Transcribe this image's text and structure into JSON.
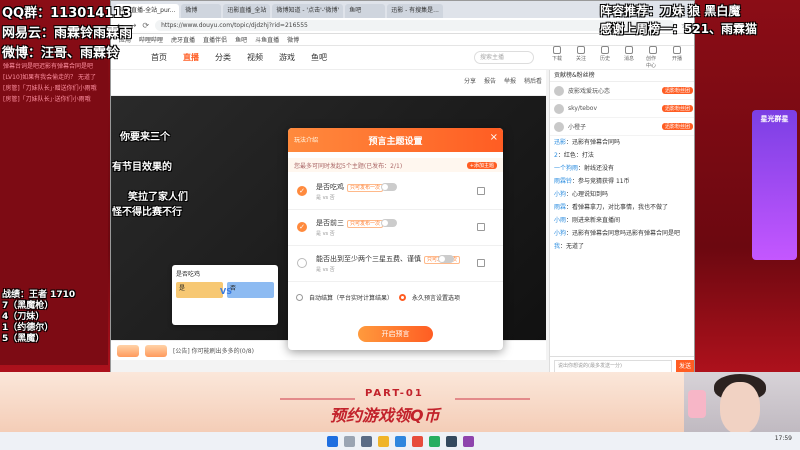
{
  "overlay": {
    "qq_group": "QQ群：113014113",
    "netease": "网易云：雨霖铃雨霖雨",
    "weibo": "微博：汪哥、雨霖铃",
    "recommend": "阵容推荐：刀妹 狼 黑白魔",
    "thanks": "感谢上周榜一：521、雨霖猫",
    "side_line1": "你要来三个",
    "side_line2": "有节目效果的",
    "side_line3": "笑拉了家人们",
    "side_line4": "怪不得比赛不行",
    "battle": [
      "战绩：王者 1710",
      "7（黑魔枪）",
      "4（刀妹）",
      "1（约德尔）",
      "5（黑魔）"
    ]
  },
  "left_chat": [
    "弹幕台词是吧迟影有弹幕合同是吧",
    "[LV10]如果有我会偷走的？ 无道了",
    "[房管]「刀妹队长」·赠送你们小雨哦",
    "[房管]「刀妹队长」·送你们小雨哦"
  ],
  "browser": {
    "tabs": [
      "斗鱼直播-全站_pur...",
      "微博",
      "迅影直播_全站",
      "微博知道 - '点击'-'微博'",
      "鱼吧",
      "迅影 - 有搜集是..."
    ],
    "url": "https://www.douyu.com/topic/djdzhj?rid=216555",
    "bookmarks": [
      "应用",
      "哔哩哔哩",
      "虎牙直播",
      "直播伴侣",
      "鱼吧",
      "斗鱼直播",
      "微博"
    ]
  },
  "nav": {
    "items": [
      "首页",
      "直播",
      "分类",
      "视频",
      "游戏",
      "鱼吧"
    ],
    "search_placeholder": "搜索主播",
    "icons": [
      "下载",
      "关注",
      "历史",
      "消息",
      "创作中心",
      "开播"
    ]
  },
  "room": {
    "actions": [
      "分享",
      "报告",
      "举报",
      "稍后看"
    ]
  },
  "gift_bar": {
    "text": "[公告] 你可能刷出多多的(0/8)"
  },
  "chat": {
    "header": "贡献榜&粉丝榜",
    "ranks": [
      {
        "name": "皮影戏爱玩心恋",
        "badge": "迅影粉丝团"
      },
      {
        "name": "sky/tebov",
        "badge": "迅影粉丝团"
      },
      {
        "name": "小橙子",
        "badge": "迅影粉丝团"
      }
    ],
    "messages": [
      {
        "user": "迅影",
        "text": "迅影有弹幕合同吗"
      },
      {
        "user": "2",
        "text": "红色：打法"
      },
      {
        "user": "一个狗雨",
        "text": "射线还没有"
      },
      {
        "user": "雨霖铃",
        "text": "参与竞猜获得 11币"
      },
      {
        "user": "小狗",
        "text": "心理说知到吗"
      },
      {
        "user": "雨霖",
        "text": "看弹幕拿刀，对比事情，我也不做了"
      },
      {
        "user": "小雨",
        "text": "刚进来新来直播间"
      },
      {
        "user": "小狗",
        "text": "迅影有弹幕会同意吗迅影有弹幕合同是吧"
      },
      {
        "user": "我",
        "text": "无道了"
      }
    ],
    "input_placeholder": "说出你想说的(最多发送一分)",
    "send": "发送"
  },
  "sidebanner": {
    "title": "星光群星"
  },
  "modal": {
    "sub": "玩法介绍",
    "title": "预言主题设置",
    "close": "×",
    "hint": "您最多可同时发起5个主题(已发布：2/1)",
    "add": "+添加主题",
    "questions": [
      {
        "title": "是否吃鸡",
        "tag": "只可发布一次",
        "opts": "是 vs 否",
        "checked": true
      },
      {
        "title": "是否前三",
        "tag": "只可发布一次",
        "opts": "是 vs 否",
        "checked": true
      },
      {
        "title": "能否出到至少两个三星五费、谨慎",
        "tag": "只可发布一次",
        "opts": "是 vs 否",
        "checked": false
      }
    ],
    "mode_auto": "自动结算（平台实时计算结果）",
    "mode_manual": "永久预言设置选项",
    "start": "开启预言"
  },
  "predict_card": {
    "title": "是否吃鸡",
    "left": "是",
    "right": "否",
    "vs": "VS"
  },
  "banner": {
    "part": "PART-01",
    "title": "预约游戏领Q币"
  },
  "taskbar": {
    "time": "17:59"
  },
  "colors": {
    "accent": "#ff5d23",
    "banner_red": "#c2222b",
    "bg_red": "#7a0a12"
  }
}
